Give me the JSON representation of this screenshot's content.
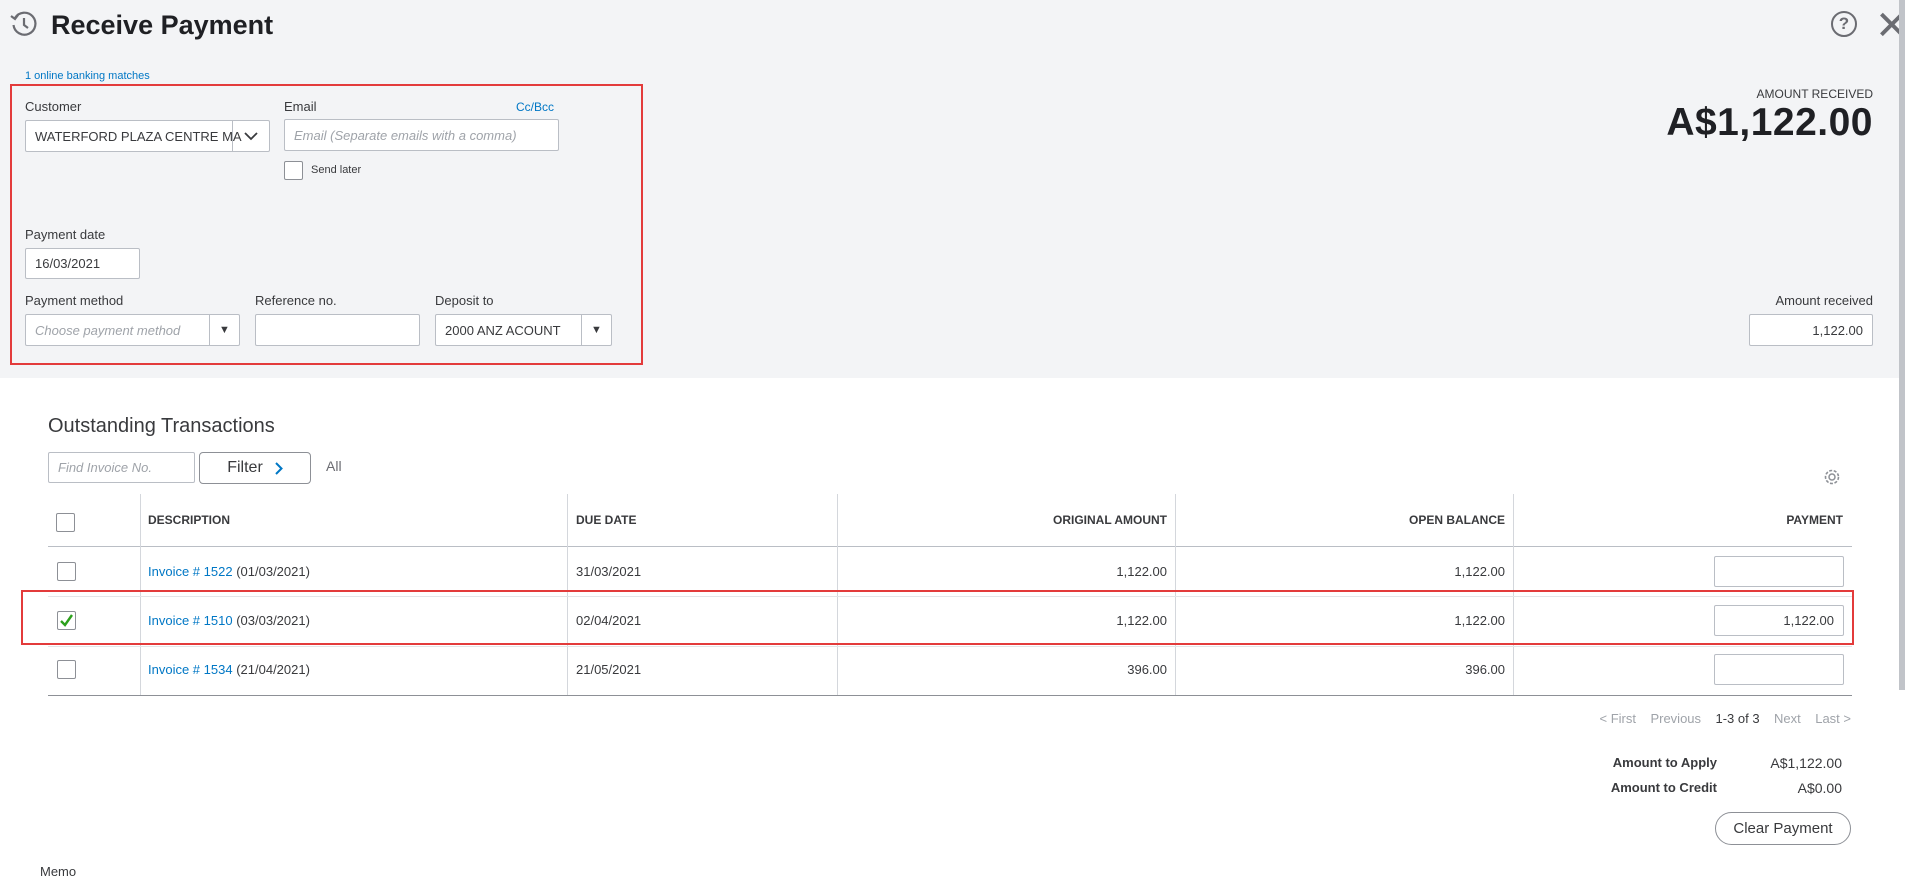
{
  "header": {
    "title": "Receive Payment",
    "history_icon": "history-clock-icon",
    "help_icon": "help-circle-icon",
    "help_glyph": "?",
    "close_icon": "close-icon",
    "close_glyph": "✕"
  },
  "banking_matches_link": "1 online banking matches",
  "form": {
    "customer_label": "Customer",
    "customer_value": "WATERFORD PLAZA CENTRE MA",
    "email_label": "Email",
    "ccbcc_link": "Cc/Bcc",
    "email_placeholder": "Email (Separate emails with a comma)",
    "send_later_label": "Send later",
    "payment_date_label": "Payment date",
    "payment_date_value": "16/03/2021",
    "payment_method_label": "Payment method",
    "payment_method_placeholder": "Choose payment method",
    "reference_label": "Reference no.",
    "reference_value": "",
    "deposit_label": "Deposit to",
    "deposit_value": "2000 ANZ ACOUNT"
  },
  "amount_summary": {
    "heading": "AMOUNT RECEIVED",
    "big_value": "A$1,122.00",
    "field_label": "Amount received",
    "field_value": "1,122.00"
  },
  "outstanding": {
    "title": "Outstanding Transactions",
    "find_placeholder": "Find Invoice No.",
    "filter_label": "Filter",
    "filter_all": "All",
    "settings_icon": "gear-icon",
    "columns": [
      "DESCRIPTION",
      "DUE DATE",
      "ORIGINAL AMOUNT",
      "OPEN BALANCE",
      "PAYMENT"
    ],
    "rows": [
      {
        "checked": false,
        "invoice": "Invoice # 1522",
        "date": "(01/03/2021)",
        "due": "31/03/2021",
        "original": "1,122.00",
        "open": "1,122.00",
        "payment": ""
      },
      {
        "checked": true,
        "invoice": "Invoice # 1510",
        "date": "(03/03/2021)",
        "due": "02/04/2021",
        "original": "1,122.00",
        "open": "1,122.00",
        "payment": "1,122.00"
      },
      {
        "checked": false,
        "invoice": "Invoice # 1534",
        "date": "(21/04/2021)",
        "due": "21/05/2021",
        "original": "396.00",
        "open": "396.00",
        "payment": ""
      }
    ]
  },
  "pagination": {
    "first": "< First",
    "previous": "Previous",
    "range": "1-3 of 3",
    "next": "Next",
    "last": "Last >"
  },
  "totals": {
    "apply_label": "Amount to Apply",
    "apply_value": "A$1,122.00",
    "credit_label": "Amount to Credit",
    "credit_value": "A$0.00",
    "clear_button": "Clear Payment"
  },
  "memo_label": "Memo",
  "colors": {
    "accent_link": "#0077c5",
    "highlight_red": "#e33b3b",
    "check_green": "#2ca01c"
  }
}
